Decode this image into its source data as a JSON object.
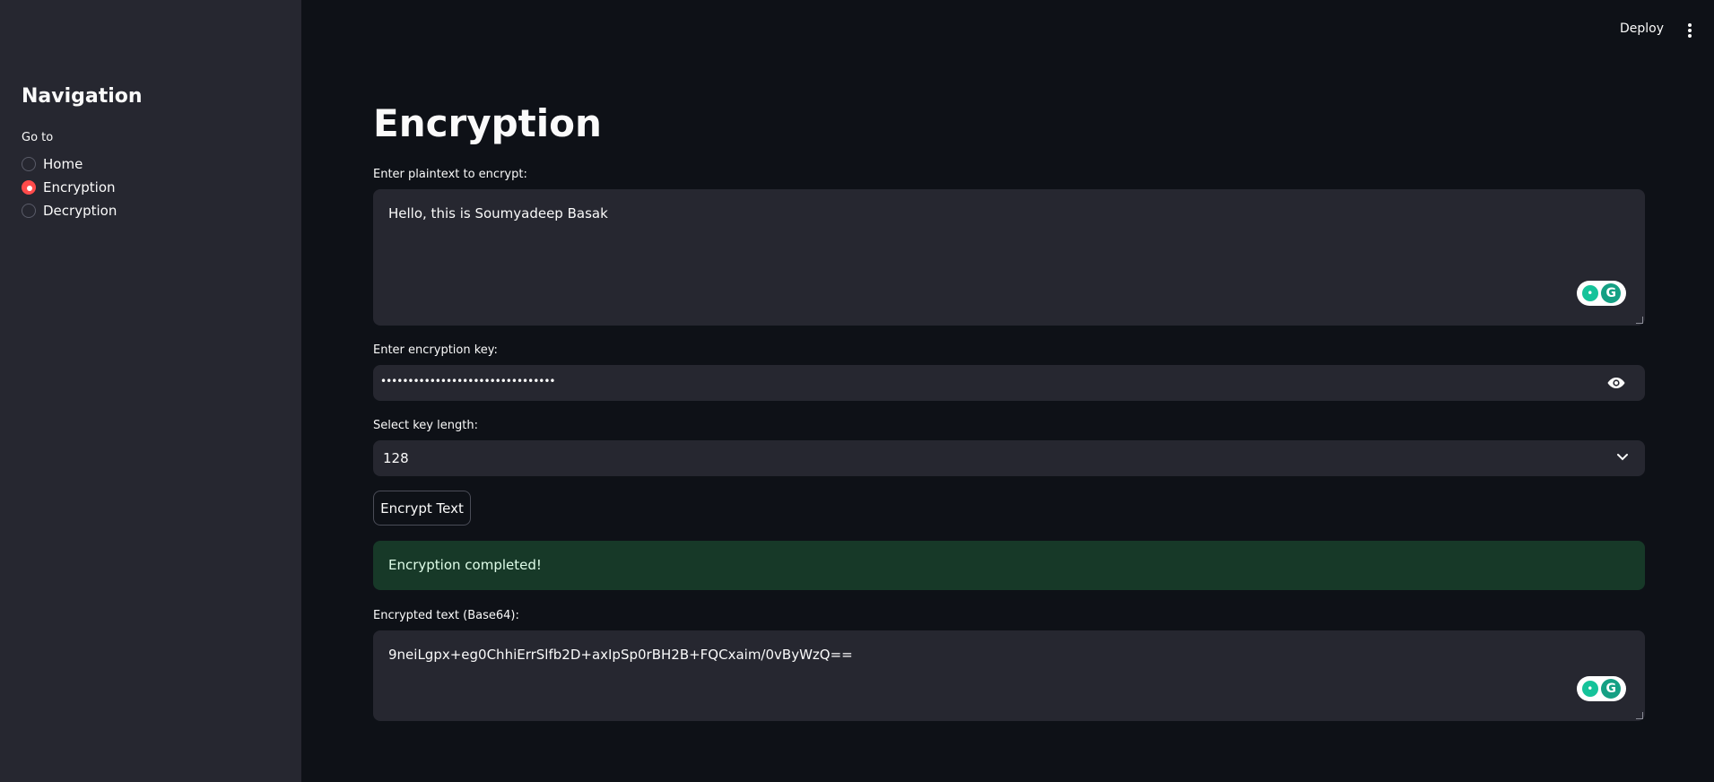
{
  "header": {
    "deploy_label": "Deploy"
  },
  "sidebar": {
    "title": "Navigation",
    "radio_label": "Go to",
    "items": [
      {
        "label": "Home",
        "selected": false
      },
      {
        "label": "Encryption",
        "selected": true
      },
      {
        "label": "Decryption",
        "selected": false
      }
    ]
  },
  "main": {
    "title": "Encryption",
    "plaintext": {
      "label": "Enter plaintext to encrypt:",
      "value": "Hello, this is Soumyadeep Basak"
    },
    "key": {
      "label": "Enter encryption key:",
      "masked_value": "••••••••••••••••••••••••••••••••"
    },
    "key_length": {
      "label": "Select key length:",
      "selected": "128"
    },
    "encrypt_button": "Encrypt Text",
    "success_message": "Encryption completed!",
    "output": {
      "label": "Encrypted text (Base64):",
      "value": "9neiLgpx+eg0ChhiErrSlfb2D+axIpSp0rBH2B+FQCxaim/0vByWzQ=="
    }
  },
  "colors": {
    "background": "#0e1117",
    "sidebar": "#262730",
    "accent": "#ff4b4b",
    "success_bg": "#173928",
    "grammarly": "#15c39a"
  }
}
